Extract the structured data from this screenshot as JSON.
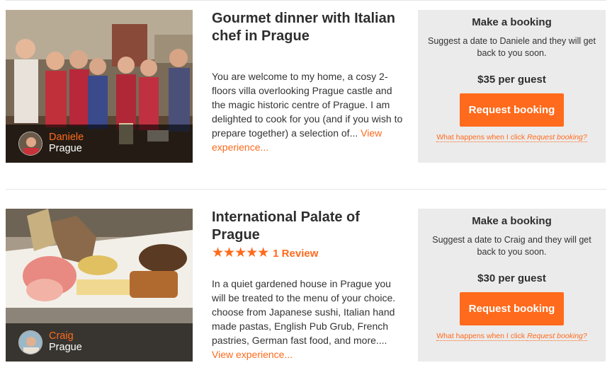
{
  "listings": [
    {
      "title": "Gourmet dinner with Italian chef in Prague",
      "rating": null,
      "description": "You are welcome to my home, a cosy 2-floors villa overlooking Prague castle and the magic historic centre of Prague. I am delighted to cook for you (and if you wish to prepare together) a selection of...",
      "view_link": "View experience...",
      "host": {
        "name": "Daniele",
        "city": "Prague"
      },
      "booking": {
        "title": "Make a booking",
        "subtitle": "Suggest a date to Daniele and they will get back to you soon.",
        "price": "$35 per guest",
        "button": "Request booking",
        "help_prefix": "What happens when I click ",
        "help_emphasis": "Request booking?"
      }
    },
    {
      "title": "International Palate of Prague",
      "rating": {
        "stars": "★★★★★",
        "reviews": "1 Review"
      },
      "description": "In a quiet gardened house in Prague you will be treated to the menu of your choice. choose from Japanese sushi, Italian hand made pastas, English Pub Grub, French pastries, German fast food, and more....",
      "view_link": "View experience...",
      "host": {
        "name": "Craig",
        "city": "Prague"
      },
      "booking": {
        "title": "Make a booking",
        "subtitle": "Suggest a date to Craig and they will get back to you soon.",
        "price": "$30 per guest",
        "button": "Request booking",
        "help_prefix": "What happens when I click ",
        "help_emphasis": "Request booking?"
      }
    }
  ],
  "colors": {
    "accent": "#ff6a1c",
    "panel": "#ebebeb",
    "text": "#2e2e2e"
  }
}
